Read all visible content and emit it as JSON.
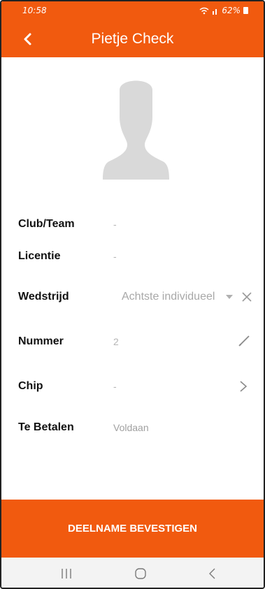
{
  "status": {
    "time": "10:58",
    "battery": "62%"
  },
  "header": {
    "title": "Pietje Check"
  },
  "fields": [
    {
      "label": "Club/Team",
      "value": "-"
    },
    {
      "label": "Licentie",
      "value": "-"
    },
    {
      "label": "Wedstrijd",
      "value": "Achtste individueel"
    },
    {
      "label": "Nummer",
      "value": "2"
    },
    {
      "label": "Chip",
      "value": "-"
    },
    {
      "label": "Te Betalen",
      "value": "Voldaan"
    }
  ],
  "footer": {
    "confirm_label": "DEELNAME BEVESTIGEN"
  },
  "colors": {
    "accent": "#f15a0f",
    "muted": "#b5b5b5",
    "avatar": "#d9d9d9"
  },
  "icons": [
    "back-chevron-icon",
    "avatar-placeholder-icon",
    "dropdown-arrow-icon",
    "clear-icon",
    "edit-pencil-icon",
    "chevron-right-icon",
    "recents-icon",
    "home-icon",
    "nav-back-icon",
    "wifi-icon",
    "signal-icon",
    "battery-icon"
  ]
}
